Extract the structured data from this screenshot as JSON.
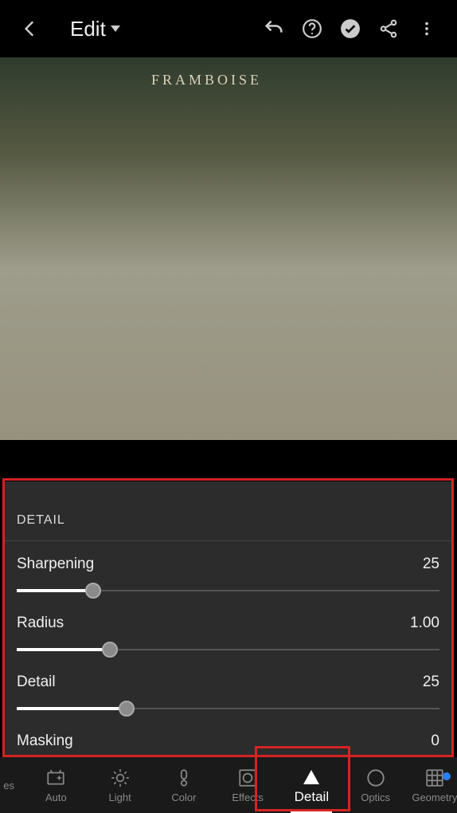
{
  "header": {
    "edit_label": "Edit"
  },
  "photo": {
    "sign_text": "FRAMBOISE"
  },
  "panel": {
    "title": "DETAIL",
    "sliders": [
      {
        "label": "Sharpening",
        "value": "25",
        "percent": 18
      },
      {
        "label": "Radius",
        "value": "1.00",
        "percent": 22
      },
      {
        "label": "Detail",
        "value": "25",
        "percent": 26
      },
      {
        "label": "Masking",
        "value": "0",
        "percent": 0
      }
    ]
  },
  "tabs": {
    "items": [
      {
        "label": "es"
      },
      {
        "label": "Auto"
      },
      {
        "label": "Light"
      },
      {
        "label": "Color"
      },
      {
        "label": "Effects"
      },
      {
        "label": "Detail"
      },
      {
        "label": "Optics"
      },
      {
        "label": "Geometry"
      }
    ],
    "active_index": 5
  }
}
